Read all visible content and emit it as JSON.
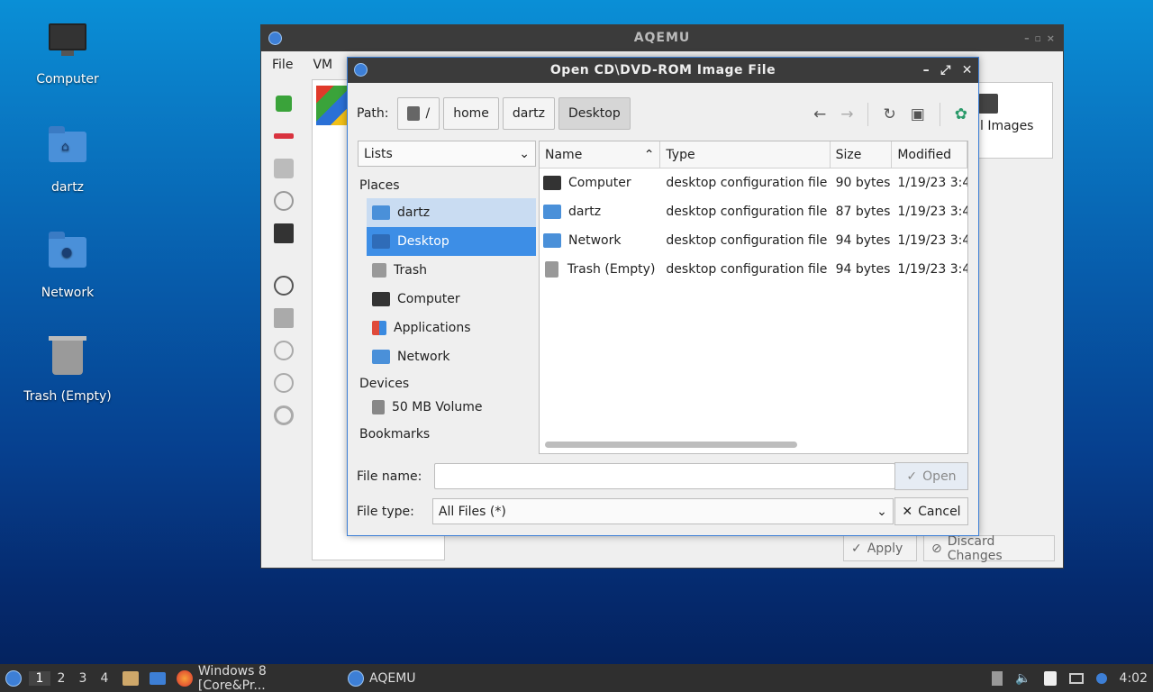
{
  "desktop": {
    "icons": [
      {
        "label": "Computer"
      },
      {
        "label": "dartz"
      },
      {
        "label": "Network"
      },
      {
        "label": "Trash (Empty)"
      }
    ]
  },
  "aqemu": {
    "title": "AQEMU",
    "window_controls": "– ▫ ×",
    "menu": {
      "file": "File",
      "vm": "VM"
    },
    "card_label": "l Images",
    "apply_label": "Apply",
    "discard_label": "Discard Changes"
  },
  "dialog": {
    "title": "Open CD\\DVD-ROM Image File",
    "path_label": "Path:",
    "crumbs": [
      "/",
      "home",
      "dartz",
      "Desktop"
    ],
    "view_select": "Lists",
    "places_header": "Places",
    "places": [
      {
        "label": "dartz"
      },
      {
        "label": "Desktop"
      },
      {
        "label": "Trash"
      },
      {
        "label": "Computer"
      },
      {
        "label": "Applications"
      },
      {
        "label": "Network"
      }
    ],
    "devices_header": "Devices",
    "devices": [
      {
        "label": "50 MB Volume"
      }
    ],
    "bookmarks_header": "Bookmarks",
    "columns": {
      "name": "Name",
      "type": "Type",
      "size": "Size",
      "modified": "Modified"
    },
    "files": [
      {
        "name": "Computer",
        "type": "desktop configuration file",
        "size": "90 bytes",
        "modified": "1/19/23 3:4"
      },
      {
        "name": "dartz",
        "type": "desktop configuration file",
        "size": "87 bytes",
        "modified": "1/19/23 3:4"
      },
      {
        "name": "Network",
        "type": "desktop configuration file",
        "size": "94 bytes",
        "modified": "1/19/23 3:4"
      },
      {
        "name": "Trash (Empty)",
        "type": "desktop configuration file",
        "size": "94 bytes",
        "modified": "1/19/23 3:4"
      }
    ],
    "file_name_label": "File name:",
    "file_name_value": "",
    "file_type_label": "File type:",
    "file_type_value": "All Files (*)",
    "open_label": "Open",
    "cancel_label": "Cancel"
  },
  "taskbar": {
    "workspaces": [
      "1",
      "2",
      "3",
      "4"
    ],
    "tasks": [
      {
        "label": "Windows 8 [Core&Pr..."
      },
      {
        "label": "AQEMU"
      }
    ],
    "clock": "4:02"
  },
  "colors": {
    "accent": "#3d8ee6",
    "titlebar": "#3b3b3b",
    "taskbar": "#2f2f2f"
  }
}
